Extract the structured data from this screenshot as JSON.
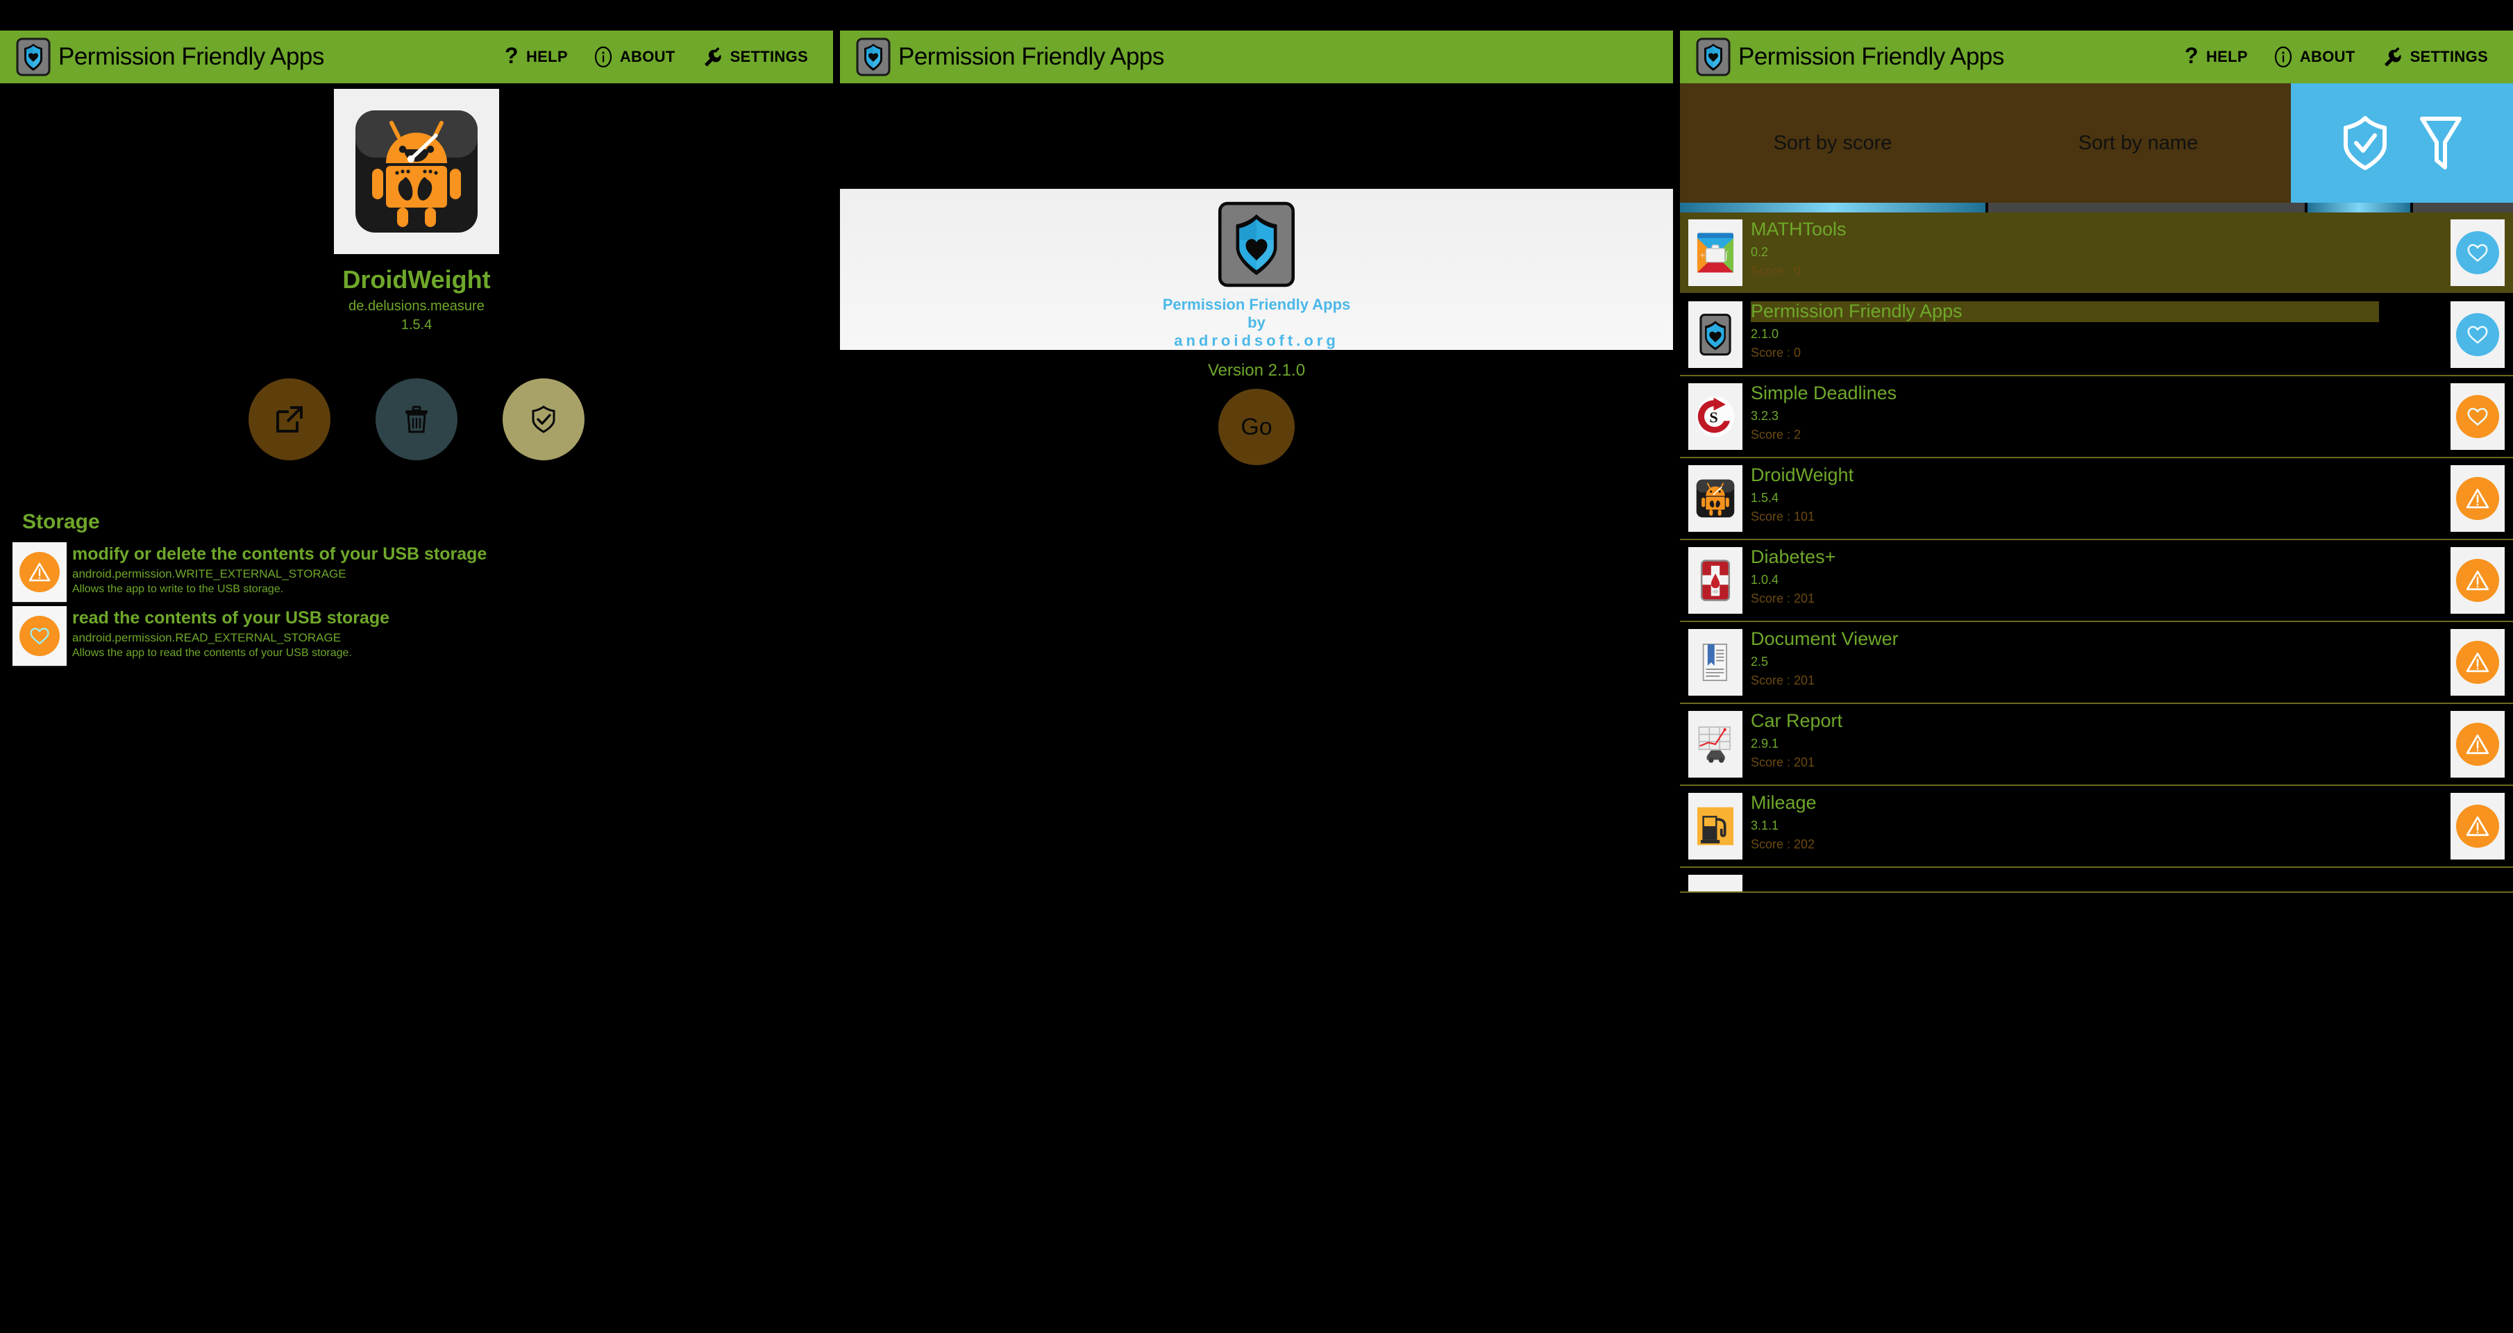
{
  "colors": {
    "brand_green": "#6FA82A",
    "accent_blue": "#4BB8E8",
    "warn_orange": "#F7931E",
    "highlight_olive": "#4F4A10",
    "tabbar_brown": "#4A3510",
    "open_btn": "#5E3F0C",
    "delete_btn": "#2E4449",
    "check_btn": "#A8A269",
    "score_text": "#6B4A10"
  },
  "actionbar": {
    "title": "Permission Friendly Apps",
    "logo_icon": "shield-heart-logo-icon",
    "actions": [
      {
        "label": "HELP",
        "icon": "question-mark-icon"
      },
      {
        "label": "ABOUT",
        "icon": "info-circle-icon"
      },
      {
        "label": "SETTINGS",
        "icon": "wrench-icon"
      }
    ]
  },
  "left_panel": {
    "app": {
      "icon": "droidweight-android-scale-icon",
      "name": "DroidWeight",
      "package": "de.delusions.measure",
      "version": "1.5.4"
    },
    "actions": [
      {
        "name": "open-app-button",
        "icon": "open-external-icon",
        "color": "#5E3F0C"
      },
      {
        "name": "delete-app-button",
        "icon": "trash-icon",
        "color": "#2E4449"
      },
      {
        "name": "verify-app-button",
        "icon": "shield-check-icon",
        "color": "#A8A269"
      }
    ],
    "permission_group": "Storage",
    "permissions": [
      {
        "badge": "warning-triangle-icon",
        "badge_color": "#F7931E",
        "title": "modify or delete the contents of your USB storage",
        "constant": "android.permission.WRITE_EXTERNAL_STORAGE",
        "description": "Allows the app to write to the USB storage."
      },
      {
        "badge": "heart-icon",
        "badge_color": "#F7931E",
        "title": "read the contents of your USB storage",
        "constant": "android.permission.READ_EXTERNAL_STORAGE",
        "description": "Allows the app to read the contents of your USB storage."
      }
    ]
  },
  "middle_panel": {
    "splash": {
      "logo_icon": "shield-heart-logo-icon",
      "line1": "Permission Friendly Apps",
      "line2": "by",
      "line3": "androidsoft.org"
    },
    "version_text": "Version 2.1.0",
    "go_label": "Go"
  },
  "right_panel": {
    "tabs": [
      {
        "label": "Sort by score",
        "selected": true
      },
      {
        "label": "Sort by name",
        "selected": false
      }
    ],
    "tab_icons": [
      {
        "name": "shield-check-icon",
        "selected": true
      },
      {
        "name": "filter-funnel-icon",
        "selected": false
      }
    ],
    "apps": [
      {
        "icon": "mathtools-icon",
        "name": "MATHTools",
        "version": "0.2",
        "score_label": "Score : 0",
        "badge": "heart-icon",
        "badge_color": "#4BB8E8",
        "row_selected": true,
        "name_highlight": false
      },
      {
        "icon": "shield-heart-logo-icon",
        "name": "Permission Friendly Apps",
        "version": "2.1.0",
        "score_label": "Score : 0",
        "badge": "heart-icon",
        "badge_color": "#4BB8E8",
        "row_selected": false,
        "name_highlight": true
      },
      {
        "icon": "simple-deadlines-icon",
        "name": "Simple Deadlines",
        "version": "3.2.3",
        "score_label": "Score : 2",
        "badge": "heart-icon",
        "badge_color": "#F7931E",
        "row_selected": false,
        "name_highlight": false
      },
      {
        "icon": "droidweight-android-scale-icon",
        "name": "DroidWeight",
        "version": "1.5.4",
        "score_label": "Score : 101",
        "badge": "warning-triangle-icon",
        "badge_color": "#F7931E",
        "row_selected": false,
        "name_highlight": false
      },
      {
        "icon": "diabetes-blood-drop-icon",
        "name": "Diabetes+",
        "version": "1.0.4",
        "score_label": "Score : 201",
        "badge": "warning-triangle-icon",
        "badge_color": "#F7931E",
        "row_selected": false,
        "name_highlight": false
      },
      {
        "icon": "document-viewer-icon",
        "name": "Document Viewer",
        "version": "2.5",
        "score_label": "Score : 201",
        "badge": "warning-triangle-icon",
        "badge_color": "#F7931E",
        "row_selected": false,
        "name_highlight": false
      },
      {
        "icon": "car-report-chart-icon",
        "name": "Car Report",
        "version": "2.9.1",
        "score_label": "Score : 201",
        "badge": "warning-triangle-icon",
        "badge_color": "#F7931E",
        "row_selected": false,
        "name_highlight": false
      },
      {
        "icon": "mileage-fuel-pump-icon",
        "name": "Mileage",
        "version": "3.1.1",
        "score_label": "Score : 202",
        "badge": "warning-triangle-icon",
        "badge_color": "#F7931E",
        "row_selected": false,
        "name_highlight": false
      }
    ]
  }
}
